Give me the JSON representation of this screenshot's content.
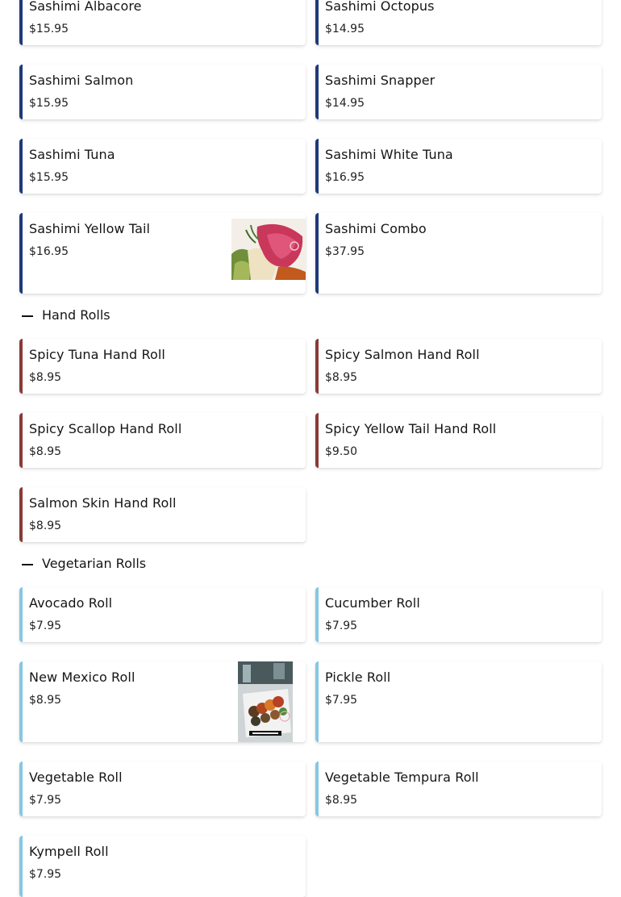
{
  "sashimi": {
    "items": [
      {
        "name": "Sashimi Albacore",
        "price": "$15.95"
      },
      {
        "name": "Sashimi Octopus",
        "price": "$14.95"
      },
      {
        "name": "Sashimi Salmon",
        "price": "$15.95"
      },
      {
        "name": "Sashimi Snapper",
        "price": "$14.95"
      },
      {
        "name": "Sashimi Tuna",
        "price": "$15.95"
      },
      {
        "name": "Sashimi White Tuna",
        "price": "$16.95"
      },
      {
        "name": "Sashimi Yellow Tail",
        "price": "$16.95"
      },
      {
        "name": "Sashimi Combo",
        "price": "$37.95"
      }
    ]
  },
  "hand_rolls": {
    "title": "Hand Rolls",
    "items": [
      {
        "name": "Spicy Tuna Hand Roll",
        "price": "$8.95"
      },
      {
        "name": "Spicy Salmon Hand Roll",
        "price": "$8.95"
      },
      {
        "name": "Spicy Scallop Hand Roll",
        "price": "$8.95"
      },
      {
        "name": "Spicy Yellow Tail Hand Roll",
        "price": "$9.50"
      },
      {
        "name": "Salmon Skin Hand Roll",
        "price": "$8.95"
      }
    ]
  },
  "vegetarian_rolls": {
    "title": "Vegetarian Rolls",
    "items": [
      {
        "name": "Avocado Roll",
        "price": "$7.95"
      },
      {
        "name": "Cucumber Roll",
        "price": "$7.95"
      },
      {
        "name": "New Mexico Roll",
        "price": "$8.95"
      },
      {
        "name": "Pickle Roll",
        "price": "$7.95"
      },
      {
        "name": "Vegetable Roll",
        "price": "$7.95"
      },
      {
        "name": "Vegetable Tempura Roll",
        "price": "$8.95"
      },
      {
        "name": "Kympell Roll",
        "price": "$7.95"
      }
    ]
  },
  "colors": {
    "sashimi_accent": "#1f3a7a",
    "hand_roll_accent": "#8a3a36",
    "vegetarian_accent": "#86c8e2"
  },
  "icons": {
    "section_toggle": "minus-icon"
  }
}
